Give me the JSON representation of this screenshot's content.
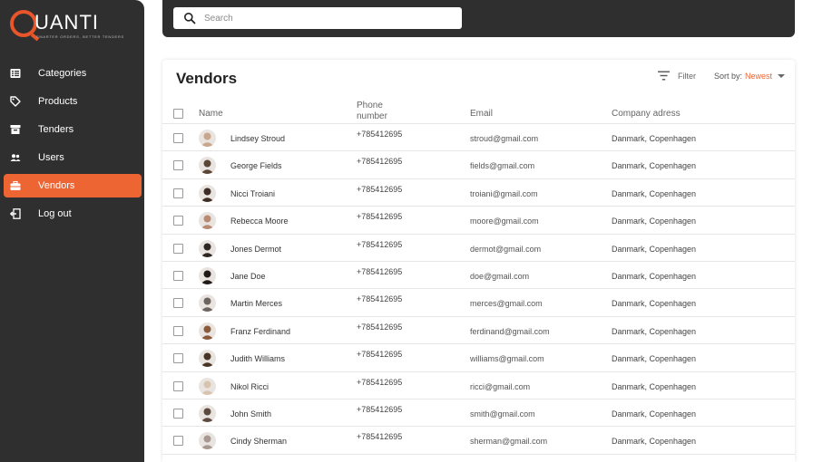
{
  "brand": {
    "name": "UANTI",
    "tagline": "SMARTER ORDERS, BETTER TENDERS"
  },
  "colors": {
    "accent": "#ee6534",
    "sidebar": "#2f2f2f"
  },
  "nav": [
    {
      "label": "Categories",
      "icon": "list-icon",
      "active": false
    },
    {
      "label": "Products",
      "icon": "tag-icon",
      "active": false
    },
    {
      "label": "Tenders",
      "icon": "archive-icon",
      "active": false
    },
    {
      "label": "Users",
      "icon": "users-icon",
      "active": false
    },
    {
      "label": "Vendors",
      "icon": "briefcase-icon",
      "active": true
    },
    {
      "label": "Log out",
      "icon": "logout-icon",
      "active": false
    }
  ],
  "search": {
    "placeholder": "Search"
  },
  "page": {
    "title": "Vendors",
    "filter_label": "Filter",
    "sort_label": "Sort by:",
    "sort_value": "Newest"
  },
  "table": {
    "columns": {
      "name": "Name",
      "phone": "Phone number",
      "email": "Email",
      "company": "Company adress"
    },
    "rows": [
      {
        "name": "Lindsey Stroud",
        "phone": "+785412695",
        "email": "stroud@gmail.com",
        "company": "Danmark, Copenhagen",
        "avatar": "#c9a58a"
      },
      {
        "name": "George Fields",
        "phone": "+785412695",
        "email": "fields@gmail.com",
        "company": "Danmark, Copenhagen",
        "avatar": "#5b4636"
      },
      {
        "name": "Nicci Troiani",
        "phone": "+785412695",
        "email": "troiani@gmail.com",
        "company": "Danmark, Copenhagen",
        "avatar": "#3e2d25"
      },
      {
        "name": "Rebecca Moore",
        "phone": "+785412695",
        "email": "moore@gmail.com",
        "company": "Danmark, Copenhagen",
        "avatar": "#b88a72"
      },
      {
        "name": "Jones Dermot",
        "phone": "+785412695",
        "email": "dermot@gmail.com",
        "company": "Danmark, Copenhagen",
        "avatar": "#2e2622"
      },
      {
        "name": "Jane Doe",
        "phone": "+785412695",
        "email": "doe@gmail.com",
        "company": "Danmark, Copenhagen",
        "avatar": "#1f1a18"
      },
      {
        "name": "Martin Merces",
        "phone": "+785412695",
        "email": "merces@gmail.com",
        "company": "Danmark, Copenhagen",
        "avatar": "#6b6460"
      },
      {
        "name": "Franz Ferdinand",
        "phone": "+785412695",
        "email": "ferdinand@gmail.com",
        "company": "Danmark, Copenhagen",
        "avatar": "#8a5a3a"
      },
      {
        "name": "Judith Williams",
        "phone": "+785412695",
        "email": "williams@gmail.com",
        "company": "Danmark, Copenhagen",
        "avatar": "#4a3426"
      },
      {
        "name": "Nikol Ricci",
        "phone": "+785412695",
        "email": "ricci@gmail.com",
        "company": "Danmark, Copenhagen",
        "avatar": "#d9c3ae"
      },
      {
        "name": "John Smith",
        "phone": "+785412695",
        "email": "smith@gmail.com",
        "company": "Danmark, Copenhagen",
        "avatar": "#5e4a3e"
      },
      {
        "name": "Cindy Sherman",
        "phone": "+785412695",
        "email": "sherman@gmail.com",
        "company": "Danmark, Copenhagen",
        "avatar": "#a89890"
      }
    ]
  }
}
